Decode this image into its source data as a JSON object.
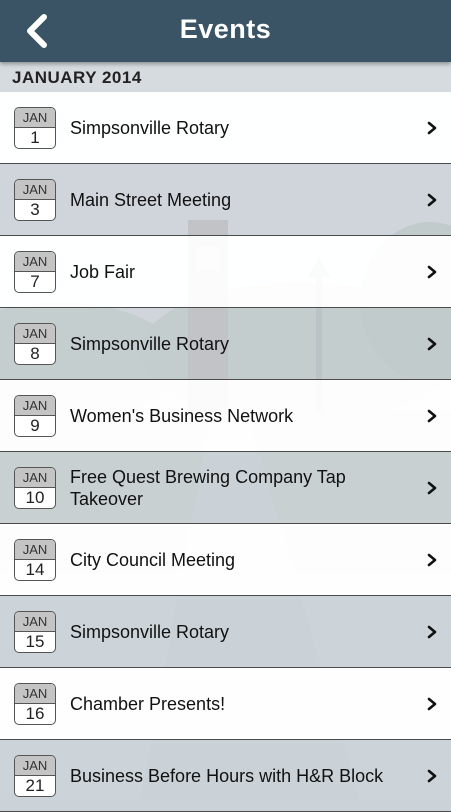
{
  "header": {
    "title": "Events",
    "back_icon": "back-chevron-icon"
  },
  "section": {
    "label": "JANUARY 2014"
  },
  "events": [
    {
      "month": "JAN",
      "day": "1",
      "title": "Simpsonville Rotary"
    },
    {
      "month": "JAN",
      "day": "3",
      "title": "Main Street Meeting"
    },
    {
      "month": "JAN",
      "day": "7",
      "title": "Job Fair"
    },
    {
      "month": "JAN",
      "day": "8",
      "title": "Simpsonville Rotary"
    },
    {
      "month": "JAN",
      "day": "9",
      "title": "Women's Business Network"
    },
    {
      "month": "JAN",
      "day": "10",
      "title": "Free Quest Brewing Company Tap Takeover"
    },
    {
      "month": "JAN",
      "day": "14",
      "title": "City Council Meeting"
    },
    {
      "month": "JAN",
      "day": "15",
      "title": "Simpsonville Rotary"
    },
    {
      "month": "JAN",
      "day": "16",
      "title": "Chamber Presents!"
    },
    {
      "month": "JAN",
      "day": "21",
      "title": "Business Before Hours with H&R Block"
    }
  ],
  "colors": {
    "header": "#3a5465",
    "row_light": "#ffffff",
    "row_dark": "#c8d0d6"
  }
}
